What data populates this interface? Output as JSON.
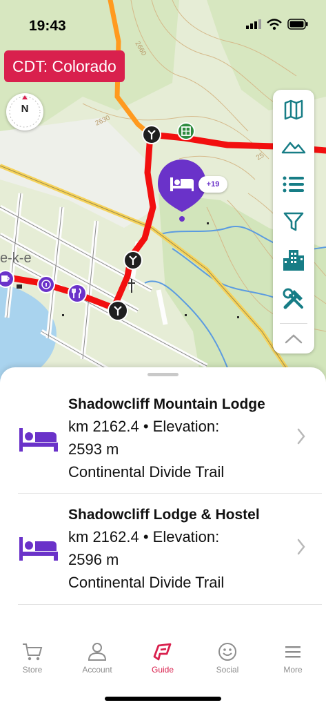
{
  "status_bar": {
    "time": "19:43"
  },
  "trail_chip": {
    "label": "CDT: Colorado",
    "color": "#d9204d"
  },
  "compass": {
    "label": "N"
  },
  "map_markers": {
    "lodge_count_badge": "+19"
  },
  "map_labels": {
    "contour_a": "2660",
    "contour_b": "2630",
    "contour_c": "25",
    "town": "e-k-e"
  },
  "tool_panel": {
    "buttons": [
      {
        "name": "map-layers-button",
        "icon": "map-icon"
      },
      {
        "name": "elevation-profile-button",
        "icon": "mountain-icon"
      },
      {
        "name": "waypoint-list-button",
        "icon": "list-icon"
      },
      {
        "name": "filter-button",
        "icon": "filter-icon"
      },
      {
        "name": "towns-button",
        "icon": "city-icon"
      },
      {
        "name": "tools-button",
        "icon": "tools-icon"
      },
      {
        "name": "collapse-panel-button",
        "icon": "chevron-up-icon"
      }
    ],
    "accent": "#177d86"
  },
  "results": [
    {
      "title": "Shadowcliff Mountain Lodge",
      "detail": "km 2162.4 • Elevation:",
      "elevation": "2593 m",
      "trail": "Continental Divide Trail"
    },
    {
      "title": "Shadowcliff Lodge & Hostel",
      "detail": "km 2162.4 • Elevation:",
      "elevation": "2596 m",
      "trail": "Continental Divide Trail"
    }
  ],
  "tabs": [
    {
      "label": "Store",
      "icon": "cart-icon",
      "active": false
    },
    {
      "label": "Account",
      "icon": "person-icon",
      "active": false
    },
    {
      "label": "Guide",
      "icon": "guide-icon",
      "active": true
    },
    {
      "label": "Social",
      "icon": "smiley-icon",
      "active": false
    },
    {
      "label": "More",
      "icon": "menu-icon",
      "active": false
    }
  ],
  "colors": {
    "lodging": "#6a32c9",
    "trail": "#f20f0f",
    "active_tab": "#d9204d"
  }
}
